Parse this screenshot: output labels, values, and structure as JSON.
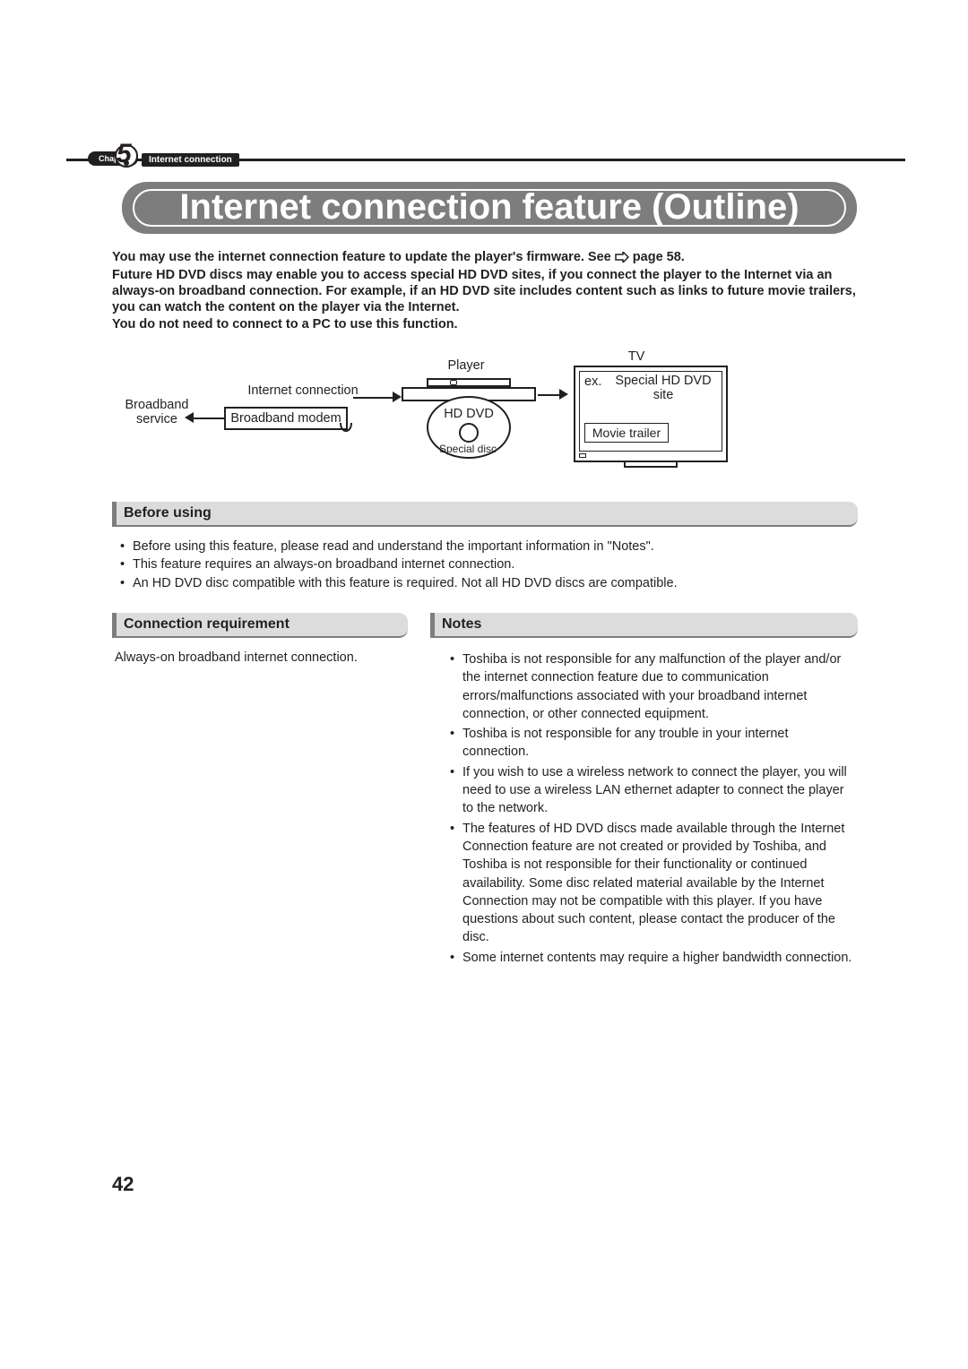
{
  "header": {
    "chapter_label": "Chapter",
    "chapter_number": "5",
    "chapter_title": "Internet connection"
  },
  "title": "Internet connection feature (Outline)",
  "intro": {
    "line1a": "You may use the internet connection feature to update the player's firmware. See ",
    "line1b": " page 58.",
    "line2": "Future HD DVD discs may enable you to access special HD DVD sites, if you connect the player to the Internet via an always-on broadband connection. For example, if an HD DVD site includes content such as links to future movie trailers, you can watch the content on the player via the Internet.",
    "line3": "You do not need to connect to a PC to use this function."
  },
  "diagram": {
    "broadband_service": "Broadband service",
    "internet_connection": "Internet connection",
    "broadband_modem": "Broadband modem",
    "player": "Player",
    "hd_dvd": "HD DVD",
    "special_disc": "Special disc",
    "tv": "TV",
    "ex": "ex.",
    "special_site": "Special HD DVD site",
    "movie_trailer": "Movie trailer"
  },
  "sections": {
    "before_using": {
      "title": "Before using",
      "items": [
        "Before using this feature, please read and understand the important information in \"Notes\".",
        "This feature requires an always-on broadband internet connection.",
        "An HD DVD disc compatible with this feature is required. Not all HD DVD discs are compatible."
      ]
    },
    "connection_requirement": {
      "title": "Connection requirement",
      "text": "Always-on broadband internet connection."
    },
    "notes": {
      "title": "Notes",
      "items": [
        "Toshiba is not responsible for any malfunction of the player and/or the internet connection feature due to communication errors/malfunctions associated with your broadband internet connection, or other connected equipment.",
        "Toshiba is not responsible for any trouble in your internet connection.",
        "If you wish to use a wireless network to connect the player, you will need to use a wireless LAN ethernet adapter to connect the player to the network.",
        "The features of HD DVD discs made available through the Internet Connection feature are not created or provided by Toshiba, and Toshiba is not responsible for their functionality or continued availability. Some disc related material available by the Internet Connection may not be compatible with this player. If you have questions about such content, please contact the producer of the disc.",
        "Some internet contents may require a higher bandwidth connection."
      ]
    }
  },
  "page_number": "42"
}
